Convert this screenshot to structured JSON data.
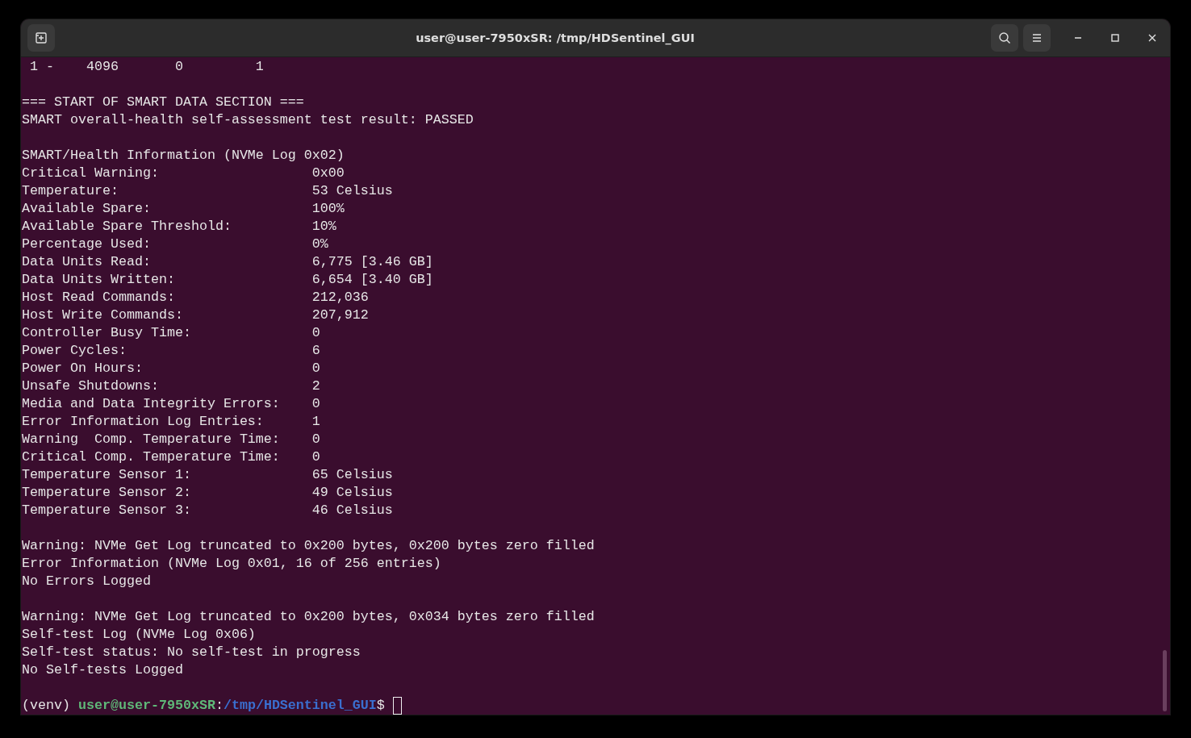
{
  "window": {
    "title": "user@user-7950xSR: /tmp/HDSentinel_GUI"
  },
  "blocks": [
    {
      "kind": "lines",
      "lines": [
        " 1 -    4096       0         1"
      ]
    },
    {
      "kind": "lines",
      "lines": [
        "=== START OF SMART DATA SECTION ===",
        "SMART overall-health self-assessment test result: PASSED"
      ]
    },
    {
      "kind": "table",
      "heading": "SMART/Health Information (NVMe Log 0x02)",
      "rows": [
        {
          "label": "Critical Warning:",
          "value": "0x00"
        },
        {
          "label": "Temperature:",
          "value": "53 Celsius"
        },
        {
          "label": "Available Spare:",
          "value": "100%"
        },
        {
          "label": "Available Spare Threshold:",
          "value": "10%"
        },
        {
          "label": "Percentage Used:",
          "value": "0%"
        },
        {
          "label": "Data Units Read:",
          "value": "6,775 [3.46 GB]"
        },
        {
          "label": "Data Units Written:",
          "value": "6,654 [3.40 GB]"
        },
        {
          "label": "Host Read Commands:",
          "value": "212,036"
        },
        {
          "label": "Host Write Commands:",
          "value": "207,912"
        },
        {
          "label": "Controller Busy Time:",
          "value": "0"
        },
        {
          "label": "Power Cycles:",
          "value": "6"
        },
        {
          "label": "Power On Hours:",
          "value": "0"
        },
        {
          "label": "Unsafe Shutdowns:",
          "value": "2"
        },
        {
          "label": "Media and Data Integrity Errors:",
          "value": "0"
        },
        {
          "label": "Error Information Log Entries:",
          "value": "1"
        },
        {
          "label": "Warning  Comp. Temperature Time:",
          "value": "0"
        },
        {
          "label": "Critical Comp. Temperature Time:",
          "value": "0"
        },
        {
          "label": "Temperature Sensor 1:",
          "value": "65 Celsius"
        },
        {
          "label": "Temperature Sensor 2:",
          "value": "49 Celsius"
        },
        {
          "label": "Temperature Sensor 3:",
          "value": "46 Celsius"
        }
      ]
    },
    {
      "kind": "lines",
      "lines": [
        "Warning: NVMe Get Log truncated to 0x200 bytes, 0x200 bytes zero filled",
        "Error Information (NVMe Log 0x01, 16 of 256 entries)",
        "No Errors Logged"
      ]
    },
    {
      "kind": "lines",
      "lines": [
        "Warning: NVMe Get Log truncated to 0x200 bytes, 0x034 bytes zero filled",
        "Self-test Log (NVMe Log 0x06)",
        "Self-test status: No self-test in progress",
        "No Self-tests Logged"
      ]
    }
  ],
  "prompt": {
    "env": "(venv)",
    "user_host": "user@user-7950xSR",
    "separator": ":",
    "path": "/tmp/HDSentinel_GUI",
    "symbol": "$"
  }
}
